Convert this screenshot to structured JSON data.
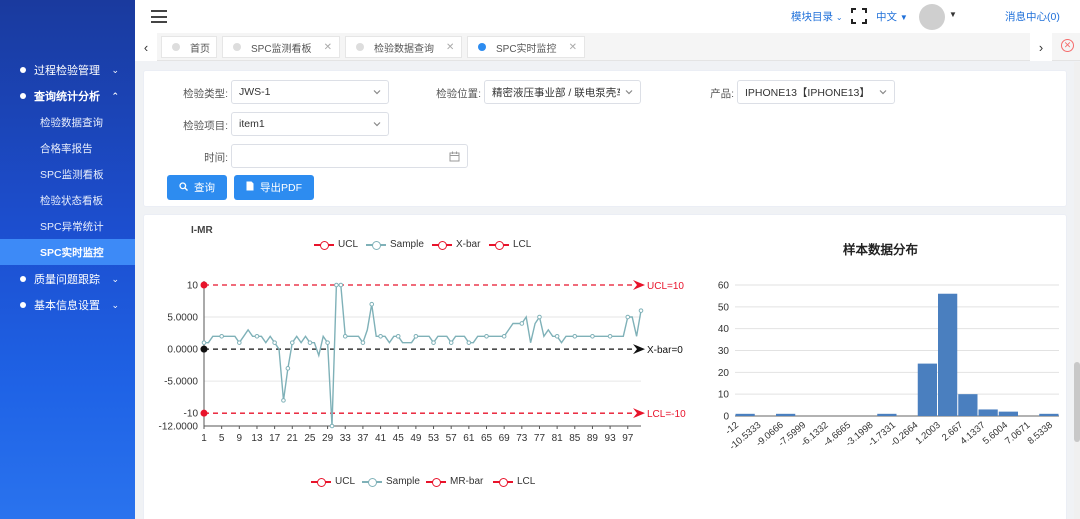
{
  "sidebar": {
    "groups": [
      {
        "label": "过程检验管理"
      },
      {
        "label": "查询统计分析"
      },
      {
        "label": "质量问题跟踪"
      },
      {
        "label": "基本信息设置"
      }
    ],
    "items": [
      {
        "label": "检验数据查询"
      },
      {
        "label": "合格率报告"
      },
      {
        "label": "SPC监测看板"
      },
      {
        "label": "检验状态看板"
      },
      {
        "label": "SPC异常统计"
      },
      {
        "label": "SPC实时监控"
      }
    ]
  },
  "header": {
    "module_menu": "模块目录",
    "language": "中文",
    "messages": "消息中心(0)"
  },
  "tabs": [
    {
      "label": "首页"
    },
    {
      "label": "SPC监测看板"
    },
    {
      "label": "检验数据查询"
    },
    {
      "label": "SPC实时监控"
    }
  ],
  "filters": {
    "inspection_type_label": "检验类型:",
    "inspection_type_value": "JWS-1",
    "location_label": "检验位置:",
    "location_value": "精密液压事业部 / 联电泵壳车间",
    "product_label": "产品:",
    "product_value": "IPHONE13【IPHONE13】",
    "item_label": "检验项目:",
    "item_value": "item1",
    "time_label": "时间:",
    "time_value": "",
    "query_button": "查询",
    "export_button": "导出PDF"
  },
  "colors": {
    "accent": "#2d8cf0",
    "sample": "#7fb1b8",
    "limit": "#e8132b",
    "bar": "#4a7fbf"
  },
  "chart_data": [
    {
      "type": "line",
      "title": "I-MR",
      "legend": [
        "UCL",
        "Sample",
        "X-bar",
        "LCL"
      ],
      "x_ticks": [
        "1",
        "5",
        "9",
        "13",
        "17",
        "21",
        "25",
        "29",
        "33",
        "37",
        "41",
        "45",
        "49",
        "53",
        "57",
        "61",
        "65",
        "69",
        "73",
        "77",
        "81",
        "85",
        "89",
        "93",
        "97"
      ],
      "y_ticks": [
        "10",
        "5.0000",
        "0.0000",
        "-5.0000",
        "-10",
        "-12.0000"
      ],
      "ylim": [
        -12,
        10
      ],
      "ucl": 10,
      "lcl": -10,
      "center": 0,
      "ucl_label": "UCL=10",
      "lcl_label": "LCL=-10",
      "center_label": "X-bar=0",
      "series": [
        {
          "name": "Sample",
          "values": [
            1,
            1,
            2,
            2,
            2,
            2,
            2,
            2,
            1,
            2,
            3,
            2,
            2,
            2,
            1,
            2,
            1,
            0,
            -8,
            -3,
            1,
            2,
            1,
            2,
            1,
            1,
            -1,
            2,
            1,
            -12,
            10,
            10,
            2,
            2,
            2,
            2,
            1,
            3,
            7,
            2,
            2,
            2,
            1,
            2,
            2,
            1,
            1,
            1,
            2,
            2,
            2,
            2,
            1,
            2,
            2,
            2,
            1,
            2,
            2,
            2,
            1,
            1,
            2,
            2,
            2,
            2,
            2,
            2,
            2,
            3,
            4,
            4,
            4,
            5,
            1,
            4,
            5,
            2,
            3,
            2,
            2,
            1,
            2,
            2,
            2,
            2,
            2,
            2,
            2,
            2,
            2,
            2,
            2,
            2,
            2,
            2,
            5,
            5,
            2,
            6
          ]
        }
      ]
    },
    {
      "type": "bar",
      "title": "样本数据分布",
      "categories": [
        "-12",
        "-10.5333",
        "-9.0666",
        "-7.5999",
        "-6.1332",
        "-4.6665",
        "-3.1998",
        "-1.7331",
        "-0.2664",
        "1.2003",
        "2.667",
        "4.1337",
        "5.6004",
        "7.0671",
        "8.5338"
      ],
      "values": [
        1,
        0,
        1,
        0,
        0,
        0,
        0,
        1,
        0,
        24,
        56,
        10,
        3,
        2,
        0,
        1
      ],
      "y_ticks": [
        "0",
        "10",
        "20",
        "30",
        "40",
        "50",
        "60"
      ],
      "ylim": [
        0,
        60
      ]
    },
    {
      "type": "line",
      "legend": [
        "UCL",
        "Sample",
        "MR-bar",
        "LCL"
      ]
    }
  ]
}
